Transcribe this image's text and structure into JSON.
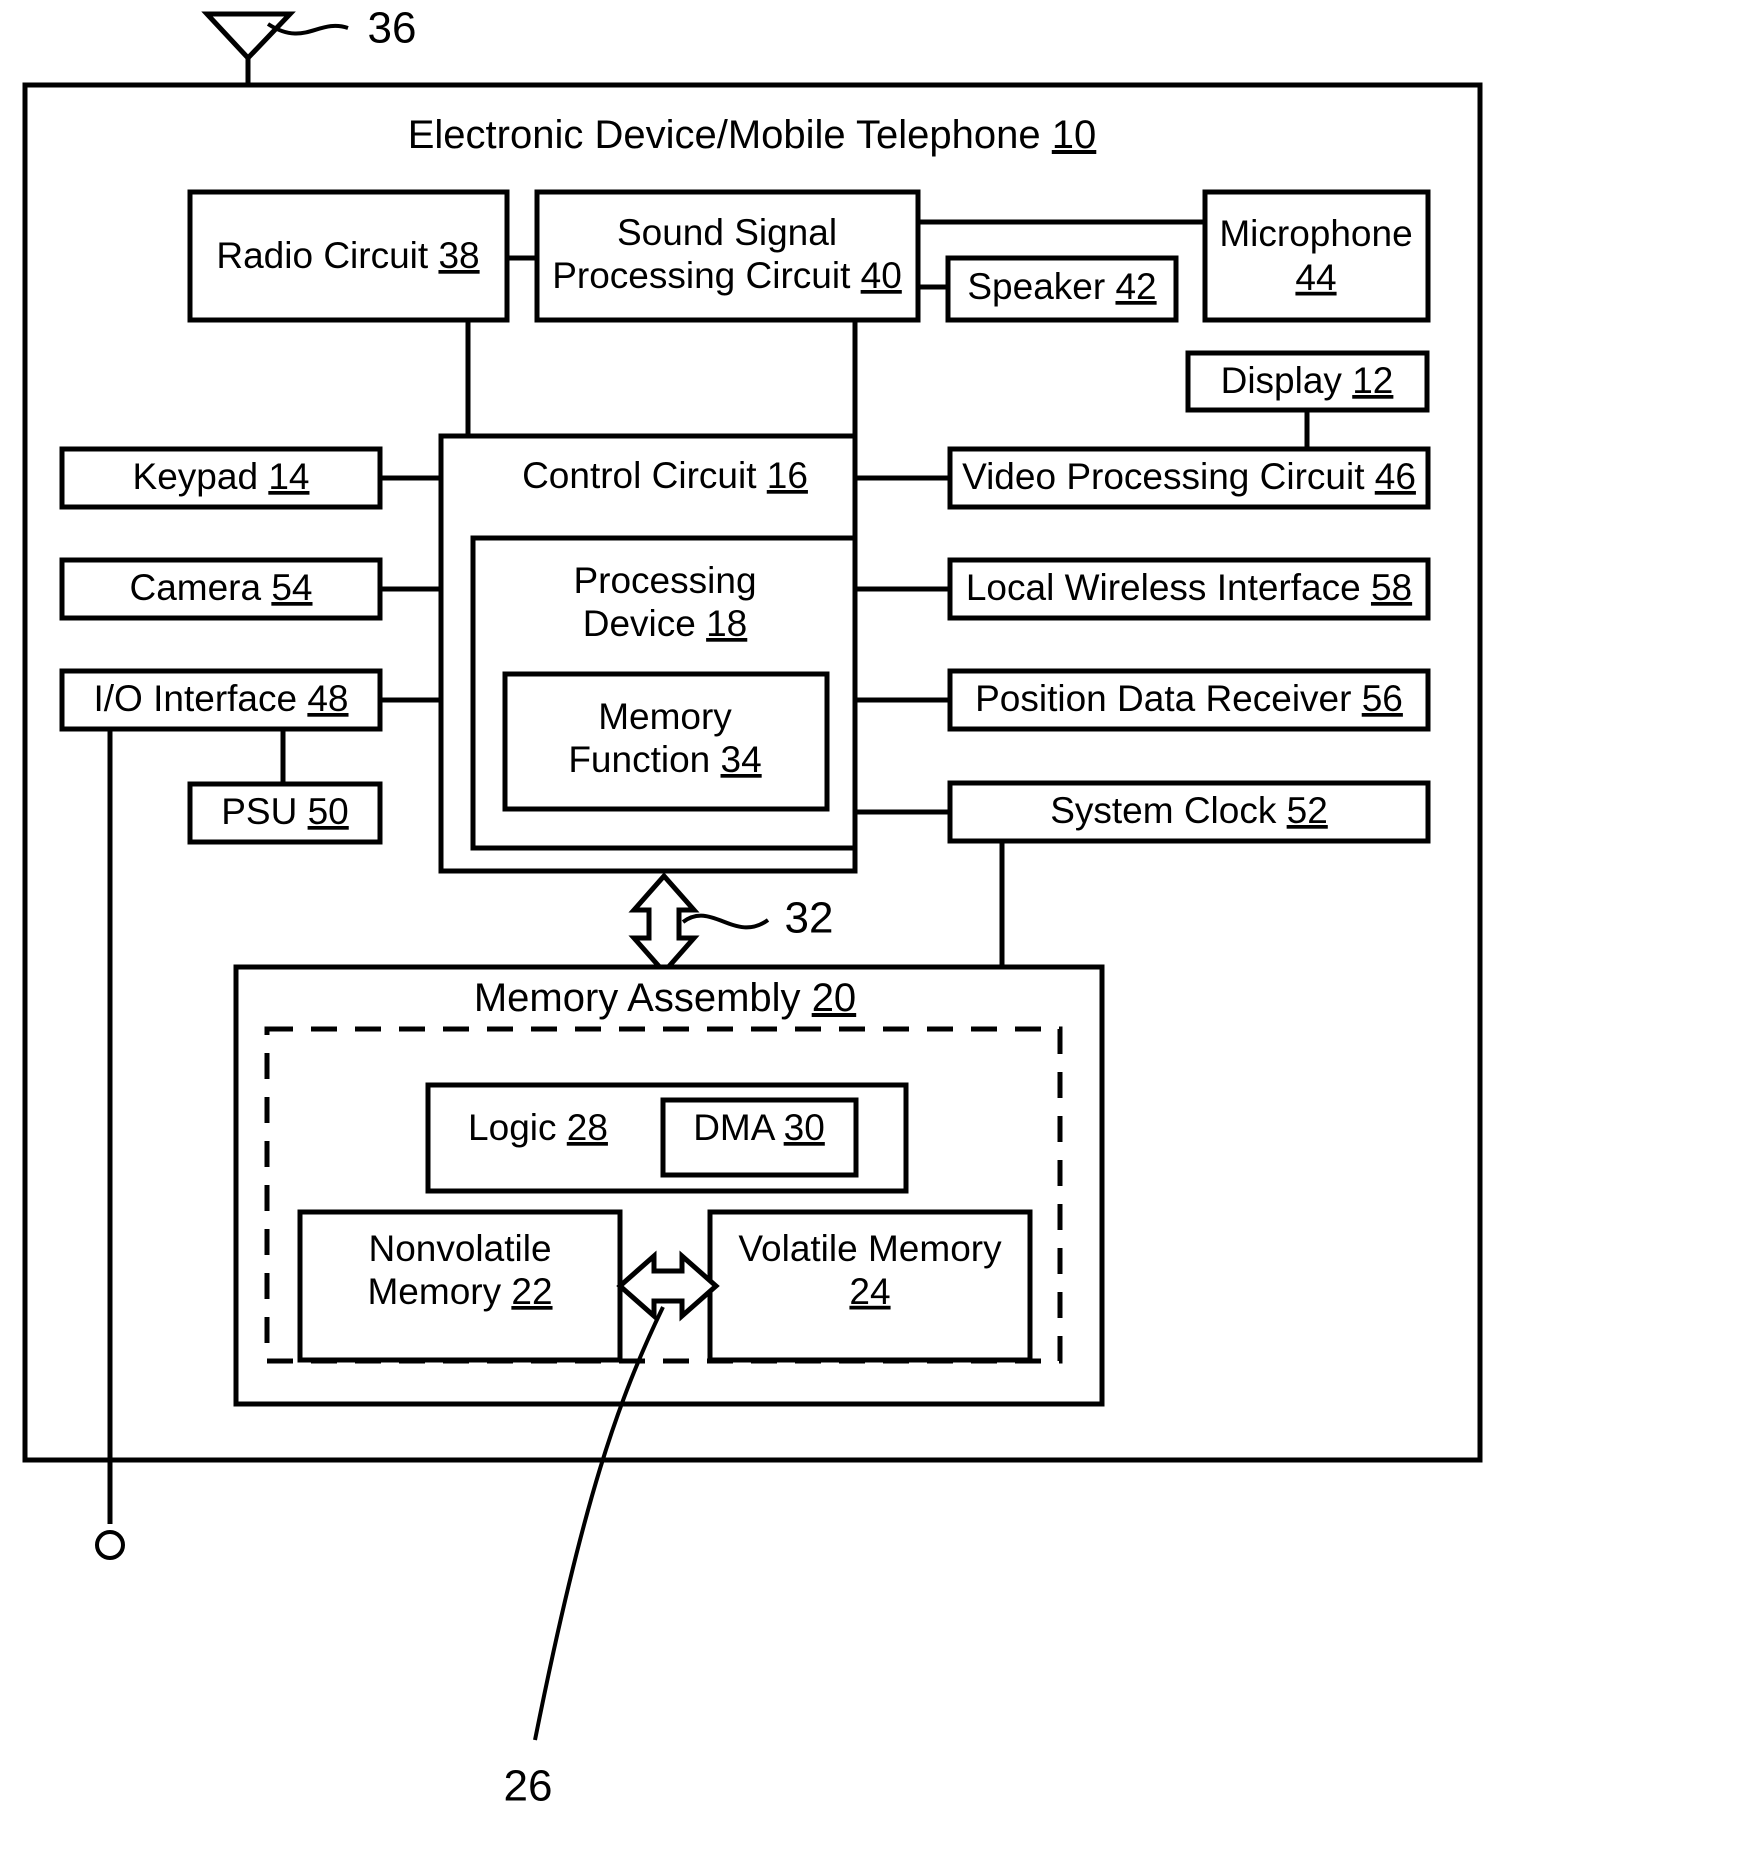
{
  "figure": {
    "title": "Electronic Device/Mobile Telephone",
    "title_ref": "10",
    "type": "patent-block-diagram"
  },
  "callouts": {
    "antenna": "36",
    "bus_32": "32",
    "memory_link_26": "26"
  },
  "blocks": {
    "device_outline": {
      "label": "Electronic Device/Mobile Telephone",
      "ref": "10"
    },
    "radio_circuit": {
      "label": "Radio Circuit",
      "ref": "38"
    },
    "sound_signal_line1": "Sound Signal",
    "sound_signal_line2": "Processing Circuit",
    "sound_signal_ref": "40",
    "speaker": {
      "label": "Speaker",
      "ref": "42"
    },
    "microphone": {
      "label": "Microphone",
      "ref": "44"
    },
    "display": {
      "label": "Display",
      "ref": "12"
    },
    "keypad": {
      "label": "Keypad",
      "ref": "14"
    },
    "camera": {
      "label": "Camera",
      "ref": "54"
    },
    "io_interface": {
      "label": "I/O Interface",
      "ref": "48"
    },
    "psu": {
      "label": "PSU",
      "ref": "50"
    },
    "control_circuit": {
      "label": "Control Circuit",
      "ref": "16"
    },
    "processing_device_line1": "Processing",
    "processing_device_line2": "Device",
    "processing_device_ref": "18",
    "memory_function_line1": "Memory",
    "memory_function_line2": "Function",
    "memory_function_ref": "34",
    "video_processing": {
      "label": "Video Processing Circuit",
      "ref": "46"
    },
    "local_wireless": {
      "label": "Local Wireless Interface",
      "ref": "58"
    },
    "position_data": {
      "label": "Position Data Receiver",
      "ref": "56"
    },
    "system_clock": {
      "label": "System Clock",
      "ref": "52"
    },
    "memory_assembly": {
      "label": "Memory Assembly",
      "ref": "20"
    },
    "logic": {
      "label": "Logic",
      "ref": "28"
    },
    "dma": {
      "label": "DMA",
      "ref": "30"
    },
    "nonvolatile_line1": "Nonvolatile",
    "nonvolatile_line2": "Memory",
    "nonvolatile_ref": "22",
    "volatile_line1": "Volatile Memory",
    "volatile_ref": "24"
  },
  "colors": {
    "stroke": "#000000",
    "fill": "#ffffff"
  }
}
